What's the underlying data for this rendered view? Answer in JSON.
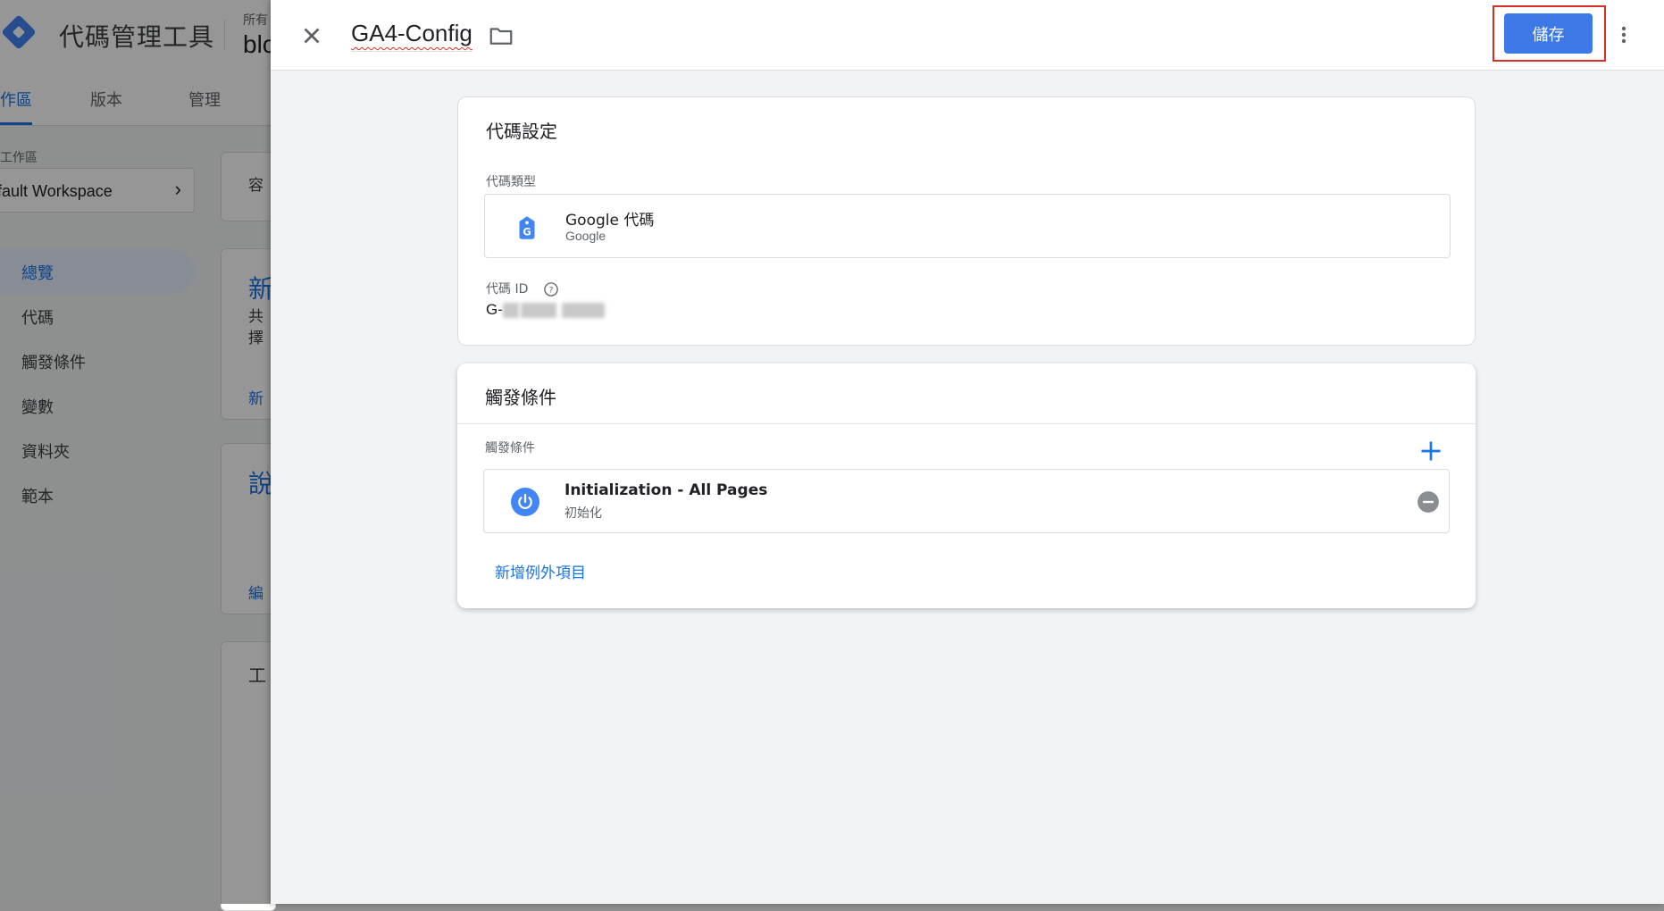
{
  "background_app": {
    "app_title": "代碼管理工具",
    "account_label": "所有",
    "account_name": "blc",
    "tabs": [
      {
        "label": "作區"
      },
      {
        "label": "版本"
      },
      {
        "label": "管理"
      }
    ],
    "workspace_label": "工作區",
    "workspace_name": "fault Workspace",
    "nav_items": [
      {
        "label": "總覽"
      },
      {
        "label": "代碼"
      },
      {
        "label": "觸發條件"
      },
      {
        "label": "變數"
      },
      {
        "label": "資料夾"
      },
      {
        "label": "範本"
      }
    ],
    "card_fragments": {
      "container": "容",
      "new_title": "新",
      "new_line1": "共",
      "new_line2": "擇",
      "new_link": "新",
      "desc_title": "說",
      "edit_link": "編",
      "work_title": "工"
    }
  },
  "editor": {
    "tag_name": "GA4-Config",
    "save_label": "儲存",
    "config_card": {
      "title": "代碼設定",
      "type_label": "代碼類型",
      "type_name": "Google 代碼",
      "type_sub": "Google",
      "tag_id_label": "代碼 ID",
      "tag_id_value": "G-"
    },
    "trigger_card": {
      "title": "觸發條件",
      "section_label": "觸發條件",
      "trigger_name": "Initialization - All Pages",
      "trigger_type": "初始化",
      "add_exception": "新增例外項目"
    }
  },
  "colors": {
    "accent": "#1a73e8",
    "save_button": "#3c78e6",
    "highlight": "#d93025"
  }
}
